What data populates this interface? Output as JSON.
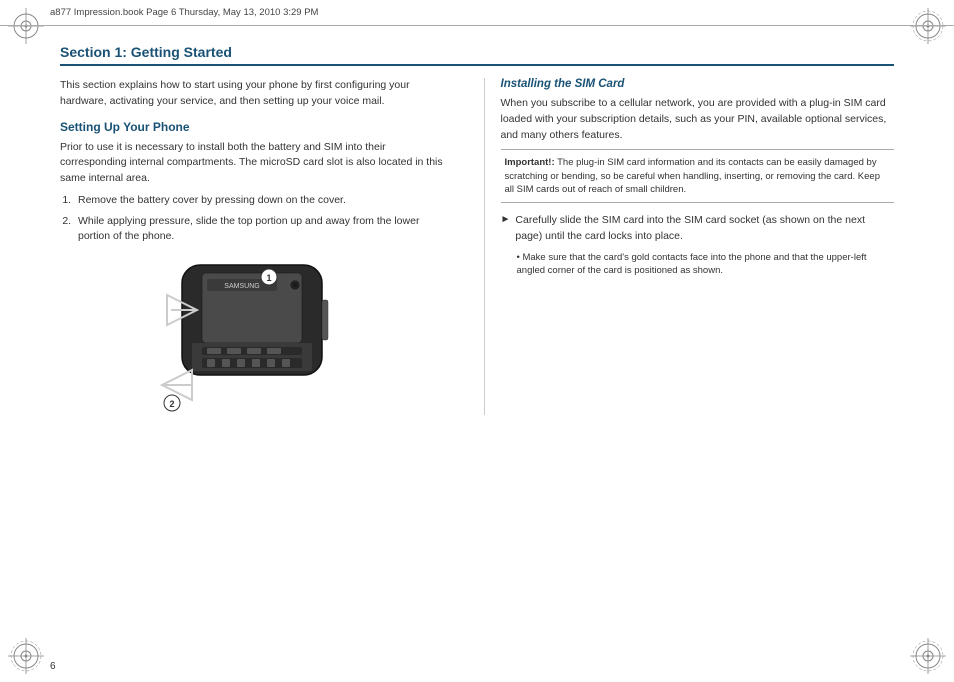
{
  "header": {
    "text": "a877 Impression.book  Page 6  Thursday, May 13, 2010  3:29 PM"
  },
  "page_number": "6",
  "section": {
    "title": "Section 1: Getting Started",
    "intro": "This section explains how to start using your phone by first configuring your hardware, activating your service, and then setting up your voice mail.",
    "subsection1": {
      "heading": "Setting Up Your Phone",
      "body": "Prior to use it is necessary to install both the battery and SIM into their corresponding internal compartments. The microSD card slot is also located in this same internal area.",
      "steps": [
        "Remove the battery cover by pressing down on the cover.",
        "While applying pressure, slide the top portion up and away from the lower portion of the phone."
      ]
    },
    "subsection2": {
      "heading": "Installing the SIM Card",
      "body": "When you subscribe to a cellular network, you are provided with a plug-in SIM card loaded with your subscription details, such as your PIN, available optional services, and many others features.",
      "important_label": "Important!:",
      "important_text": " The plug-in SIM card information and its contacts can be easily damaged by scratching or bending, so be careful when handling, inserting, or removing the card. Keep all SIM cards out of reach of small children.",
      "bullet_text": "Carefully slide the SIM card into the SIM card socket (as shown on the next page) until the card locks into place.",
      "sub_bullet": "Make sure that the card's gold contacts face into the phone and that the upper-left angled corner of the card is positioned as shown."
    }
  }
}
